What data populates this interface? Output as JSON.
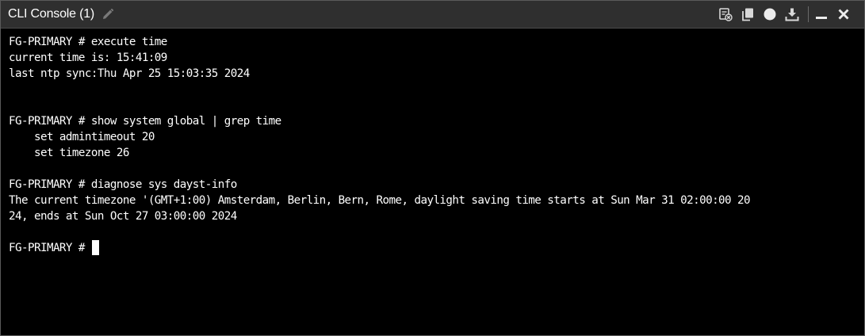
{
  "window": {
    "title": "CLI Console (1)"
  },
  "icons": {
    "edit": "pencil-icon",
    "clear": "clear-console-icon",
    "copy": "copy-icon",
    "record": "record-icon",
    "download": "download-icon",
    "minimize": "minimize-icon",
    "close": "close-icon"
  },
  "colors": {
    "titlebar_bg": "#2f2f2f",
    "console_bg": "#000000",
    "console_text": "#ffffff",
    "icon": "#d8d8d8"
  },
  "console": {
    "lines": [
      "FG-PRIMARY # execute time",
      "current time is: 15:41:09",
      "last ntp sync:Thu Apr 25 15:03:35 2024",
      "",
      "",
      "FG-PRIMARY # show system global | grep time",
      "    set admintimeout 20",
      "    set timezone 26",
      "",
      "FG-PRIMARY # diagnose sys dayst-info",
      "The current timezone '(GMT+1:00) Amsterdam, Berlin, Bern, Rome, daylight saving time starts at Sun Mar 31 02:00:00 20",
      "24, ends at Sun Oct 27 03:00:00 2024",
      ""
    ],
    "prompt": "FG-PRIMARY # "
  }
}
